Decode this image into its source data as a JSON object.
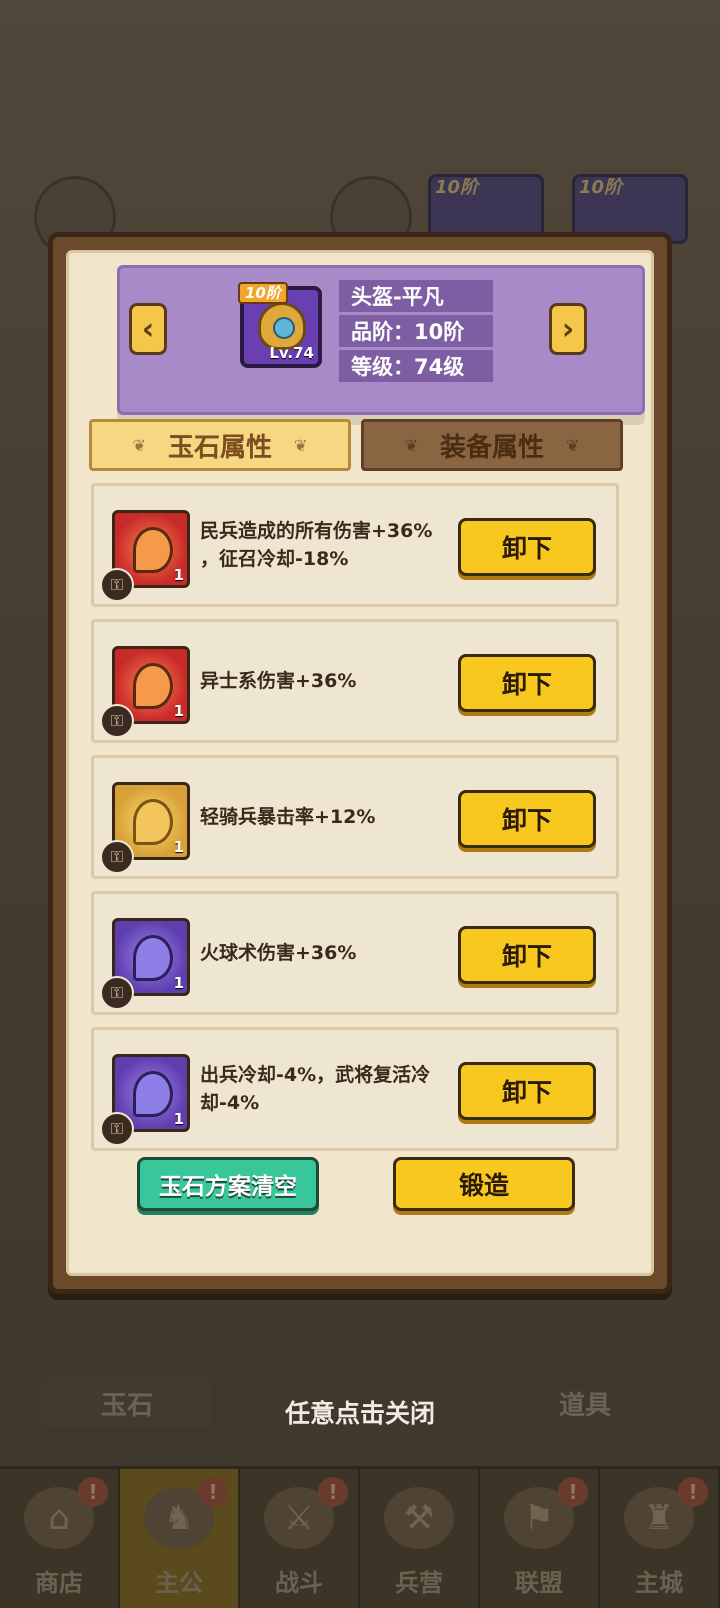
{
  "header": {
    "item_name": "头盔-平凡",
    "quality": "品阶：10阶",
    "level": "等级：74级",
    "tier_badge": "10阶",
    "item_level": "Lv.74"
  },
  "tabs": {
    "jade": "玉石属性",
    "equipment": "装备属性"
  },
  "gems": [
    {
      "color": "red",
      "count": "1",
      "line1": "民兵造成的所有伤害+36%",
      "line2": "，征召冷却-18%",
      "button": "卸下"
    },
    {
      "color": "red",
      "count": "1",
      "line1": "异士系伤害+36%",
      "line2": "",
      "button": "卸下"
    },
    {
      "color": "gold",
      "count": "1",
      "line1": "轻骑兵暴击率+12%",
      "line2": "",
      "button": "卸下"
    },
    {
      "color": "purple",
      "count": "1",
      "line1": "火球术伤害+36%",
      "line2": "",
      "button": "卸下"
    },
    {
      "color": "purple",
      "count": "1",
      "line1": "出兵冷却-4%，武将复活冷",
      "line2": "却-4%",
      "button": "卸下"
    }
  ],
  "actions": {
    "clear": "玉石方案清空",
    "forge": "锻造"
  },
  "close_hint": "任意点击关闭",
  "background": {
    "card_tiers": [
      "10阶",
      "10阶"
    ],
    "tabs": [
      "玉石",
      "道具"
    ],
    "nav": [
      {
        "label": "商店",
        "icon": "shop-icon"
      },
      {
        "label": "主公",
        "icon": "lord-icon"
      },
      {
        "label": "战斗",
        "icon": "battle-icon"
      },
      {
        "label": "兵营",
        "icon": "barracks-icon"
      },
      {
        "label": "联盟",
        "icon": "alliance-icon"
      },
      {
        "label": "主城",
        "icon": "city-icon"
      }
    ],
    "badge": "!"
  },
  "colors": {
    "button_yellow": "#f8c81e",
    "button_green": "#38c79a",
    "header_purple": "#a98ac9"
  }
}
